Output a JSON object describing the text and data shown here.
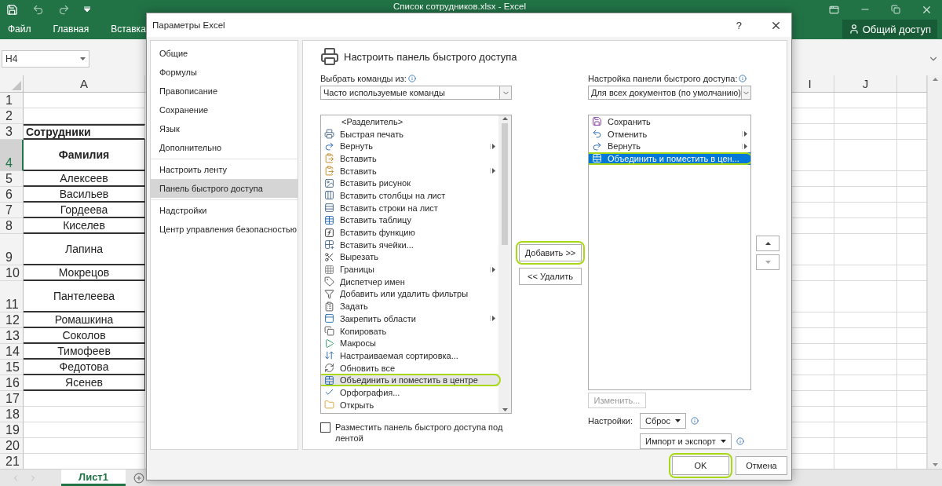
{
  "excel": {
    "title_bar": {
      "title": "Список сотрудников.xlsx - Excel"
    },
    "ribbon_tabs": [
      {
        "label": "Файл"
      },
      {
        "label": "Главная"
      },
      {
        "label": "Вставка"
      }
    ],
    "share_button": {
      "label": "Общий доступ"
    },
    "name_box": {
      "value": "H4"
    },
    "columns": [
      {
        "label": "A",
        "selected": false
      },
      {
        "label": "I",
        "selected": false
      },
      {
        "label": "J",
        "selected": false
      }
    ],
    "rows": [
      {
        "number": "1",
        "selected": false,
        "tall": false,
        "kind": "blank"
      },
      {
        "number": "2",
        "selected": false,
        "tall": false,
        "kind": "blank"
      },
      {
        "number": "3",
        "selected": false,
        "tall": false,
        "kind": "title",
        "value": "Сотрудники"
      },
      {
        "number": "4",
        "selected": true,
        "tall": true,
        "kind": "header",
        "value": "Фамилия"
      },
      {
        "number": "5",
        "selected": false,
        "tall": false,
        "kind": "name",
        "value": "Алексеев"
      },
      {
        "number": "6",
        "selected": false,
        "tall": false,
        "kind": "name",
        "value": "Васильев"
      },
      {
        "number": "7",
        "selected": false,
        "tall": false,
        "kind": "name",
        "value": "Гордеева"
      },
      {
        "number": "8",
        "selected": false,
        "tall": false,
        "kind": "name",
        "value": "Киселев"
      },
      {
        "number": "9",
        "selected": false,
        "tall": true,
        "kind": "name",
        "value": "Лапина"
      },
      {
        "number": "10",
        "selected": false,
        "tall": false,
        "kind": "name",
        "value": "Мокрецов"
      },
      {
        "number": "11",
        "selected": false,
        "tall": true,
        "kind": "name",
        "value": "Пантелеева"
      },
      {
        "number": "12",
        "selected": false,
        "tall": false,
        "kind": "name",
        "value": "Ромашкина"
      },
      {
        "number": "13",
        "selected": false,
        "tall": false,
        "kind": "name",
        "value": "Соколов"
      },
      {
        "number": "14",
        "selected": false,
        "tall": false,
        "kind": "name",
        "value": "Тимофеев"
      },
      {
        "number": "15",
        "selected": false,
        "tall": false,
        "kind": "name",
        "value": "Федотова"
      },
      {
        "number": "16",
        "selected": false,
        "tall": false,
        "kind": "name",
        "value": "Ясенев"
      },
      {
        "number": "17",
        "selected": false,
        "tall": false,
        "kind": "blank"
      },
      {
        "number": "18",
        "selected": false,
        "tall": false,
        "kind": "blank"
      },
      {
        "number": "19",
        "selected": false,
        "tall": false,
        "kind": "blank"
      },
      {
        "number": "20",
        "selected": false,
        "tall": false,
        "kind": "blank"
      },
      {
        "number": "21",
        "selected": false,
        "tall": false,
        "kind": "blank"
      }
    ],
    "sheet_tabs": [
      {
        "label": "Лист1",
        "selected": true
      }
    ]
  },
  "dialog": {
    "title": "Параметры Excel",
    "help": "?",
    "nav": [
      {
        "items": [
          {
            "label": "Общие",
            "selected": false
          },
          {
            "label": "Формулы",
            "selected": false
          },
          {
            "label": "Правописание",
            "selected": false
          },
          {
            "label": "Сохранение",
            "selected": false
          },
          {
            "label": "Язык",
            "selected": false
          },
          {
            "label": "Дополнительно",
            "selected": false
          }
        ]
      },
      {
        "items": [
          {
            "label": "Настроить ленту",
            "selected": false
          },
          {
            "label": "Панель быстрого доступа",
            "selected": true
          }
        ]
      },
      {
        "items": [
          {
            "label": "Надстройки",
            "selected": false
          },
          {
            "label": "Центр управления безопасностью",
            "selected": false
          }
        ]
      }
    ],
    "heading": "Настроить панель быстрого доступа",
    "commands_from": {
      "label": "Выбрать команды из:",
      "value": "Часто используемые команды"
    },
    "commands": [
      {
        "kind": "separator",
        "label": "<Разделитель>",
        "submenu": false,
        "selected": false,
        "annotated": false
      },
      {
        "kind": "command",
        "label": "Быстрая печать",
        "submenu": false,
        "selected": false,
        "annotated": false
      },
      {
        "kind": "command",
        "label": "Вернуть",
        "submenu": true,
        "selected": false,
        "annotated": false
      },
      {
        "kind": "command",
        "label": "Вставить",
        "submenu": false,
        "selected": false,
        "annotated": false
      },
      {
        "kind": "command",
        "label": "Вставить",
        "submenu": true,
        "selected": false,
        "annotated": false
      },
      {
        "kind": "command",
        "label": "Вставить рисунок",
        "submenu": false,
        "selected": false,
        "annotated": false
      },
      {
        "kind": "command",
        "label": "Вставить столбцы на лист",
        "submenu": false,
        "selected": false,
        "annotated": false
      },
      {
        "kind": "command",
        "label": "Вставить строки на лист",
        "submenu": false,
        "selected": false,
        "annotated": false
      },
      {
        "kind": "command",
        "label": "Вставить таблицу",
        "submenu": false,
        "selected": false,
        "annotated": false
      },
      {
        "kind": "command",
        "label": "Вставить функцию",
        "submenu": false,
        "selected": false,
        "annotated": false
      },
      {
        "kind": "command",
        "label": "Вставить ячейки...",
        "submenu": false,
        "selected": false,
        "annotated": false
      },
      {
        "kind": "command",
        "label": "Вырезать",
        "submenu": false,
        "selected": false,
        "annotated": false
      },
      {
        "kind": "command",
        "label": "Границы",
        "submenu": true,
        "selected": false,
        "annotated": false
      },
      {
        "kind": "command",
        "label": "Диспетчер имен",
        "submenu": false,
        "selected": false,
        "annotated": false
      },
      {
        "kind": "command",
        "label": "Добавить или удалить фильтры",
        "submenu": false,
        "selected": false,
        "annotated": false
      },
      {
        "kind": "command",
        "label": "Задать",
        "submenu": false,
        "selected": false,
        "annotated": false
      },
      {
        "kind": "command",
        "label": "Закрепить области",
        "submenu": true,
        "selected": false,
        "annotated": false
      },
      {
        "kind": "command",
        "label": "Копировать",
        "submenu": false,
        "selected": false,
        "annotated": false
      },
      {
        "kind": "command",
        "label": "Макросы",
        "submenu": false,
        "selected": false,
        "annotated": false
      },
      {
        "kind": "command",
        "label": "Настраиваемая сортировка...",
        "submenu": false,
        "selected": false,
        "annotated": false
      },
      {
        "kind": "command",
        "label": "Обновить все",
        "submenu": false,
        "selected": false,
        "annotated": false
      },
      {
        "kind": "command",
        "label": "Объединить и поместить в центре",
        "submenu": false,
        "selected": true,
        "annotated": true
      },
      {
        "kind": "command",
        "label": "Орфография...",
        "submenu": false,
        "selected": false,
        "annotated": false
      },
      {
        "kind": "command",
        "label": "Открыть",
        "submenu": false,
        "selected": false,
        "annotated": false
      }
    ],
    "below_ribbon": {
      "label": "Разместить панель быстрого доступа под лентой",
      "checked": false
    },
    "add_button": {
      "label": "Добавить >>",
      "annotated": true
    },
    "remove_button": {
      "label": "<< Удалить"
    },
    "toolbar_for": {
      "label": "Настройка панели быстрого доступа:",
      "value": "Для всех документов (по умолчанию)"
    },
    "toolbar_commands": [
      {
        "label": "Сохранить",
        "submenu": false,
        "selected": false,
        "annotated": false
      },
      {
        "label": "Отменить",
        "submenu": true,
        "selected": false,
        "annotated": false
      },
      {
        "label": "Вернуть",
        "submenu": true,
        "selected": false,
        "annotated": false
      },
      {
        "label": "Объединить и поместить в цен...",
        "submenu": false,
        "selected": true,
        "annotated": true
      }
    ],
    "modify_button": {
      "label": "Изменить...",
      "disabled": true
    },
    "customizations": {
      "label": "Настройки:",
      "reset": "Сброс",
      "import_export": "Импорт и экспорт"
    },
    "ok_button": {
      "label": "OK",
      "annotated": true
    },
    "cancel_button": {
      "label": "Отмена"
    }
  }
}
